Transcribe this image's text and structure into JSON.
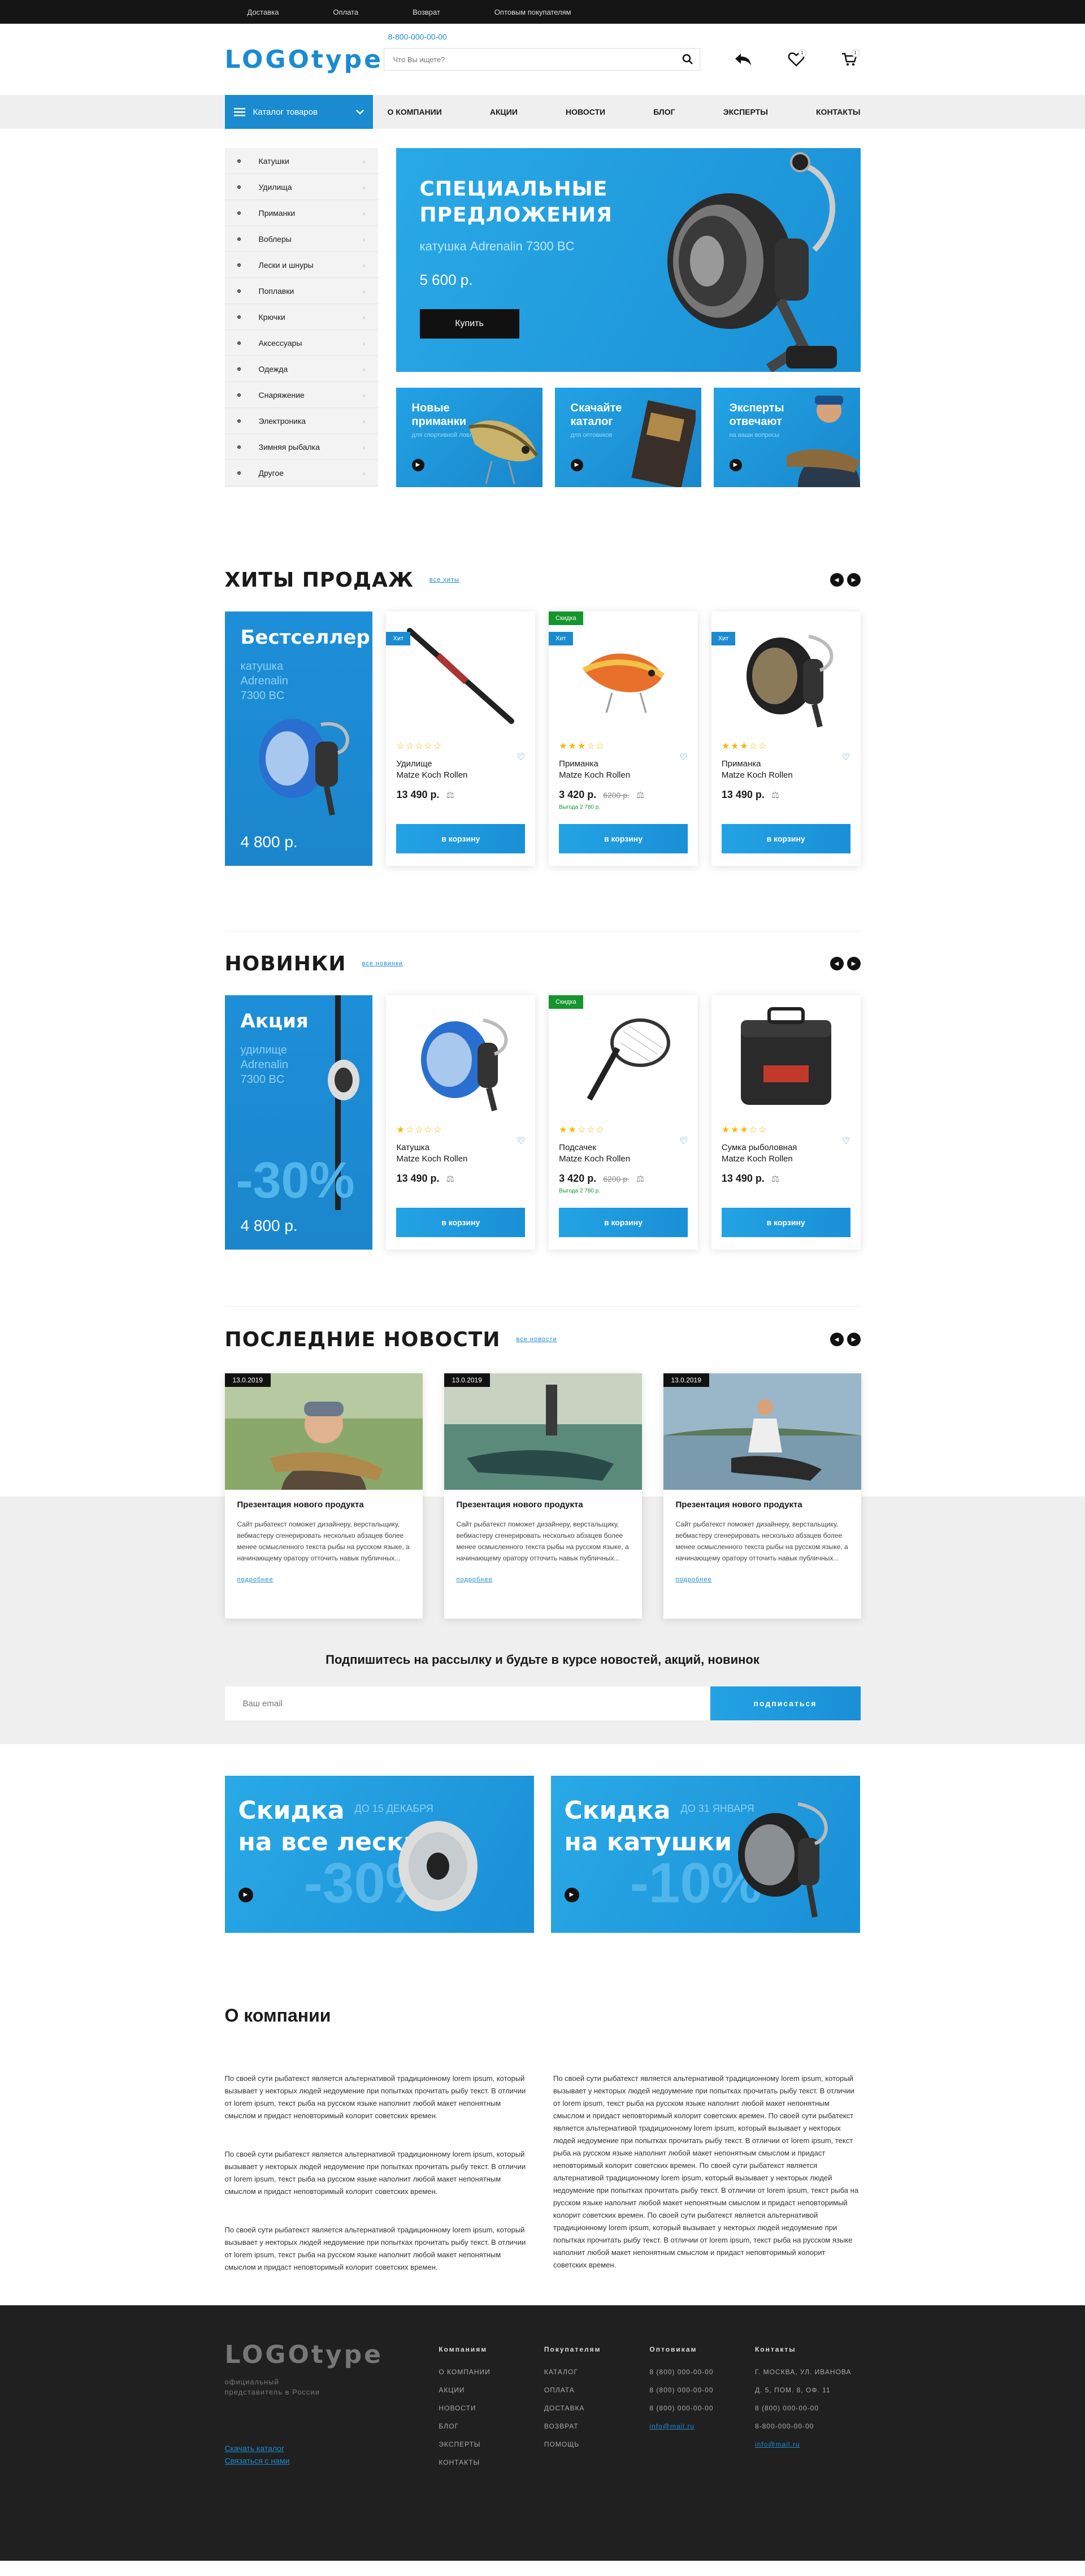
{
  "topbar": {
    "links": [
      "Доставка",
      "Оплата",
      "Возврат",
      "Оптовым покупателям"
    ]
  },
  "header": {
    "logo": "LOGOtype",
    "phone": "8-800-000-00-00",
    "search_placeholder": "Что Вы ищете?",
    "wishlist_count": "1",
    "cart_count": "1"
  },
  "nav": {
    "catalog_label": "Каталог товаров",
    "links": [
      "О КОМПАНИИ",
      "АКЦИИ",
      "НОВОСТИ",
      "БЛОГ",
      "ЭКСПЕРТЫ",
      "КОНТАКТЫ"
    ]
  },
  "categories": [
    "Катушки",
    "Удилища",
    "Приманки",
    "Воблеры",
    "Лески и шнуры",
    "Поплавки",
    "Крючки",
    "Аксессуары",
    "Одежда",
    "Снаряжение",
    "Электроника",
    "Зимняя рыбалка",
    "Другое"
  ],
  "hero": {
    "title_line1": "СПЕЦИАЛЬНЫЕ",
    "title_line2": "ПРЕДЛОЖЕНИЯ",
    "subtitle": "катушка Adrenalin 7300 BC",
    "price": "5 600 р.",
    "buy_label": "Купить"
  },
  "tiles": [
    {
      "title": "Новые приманки",
      "small": "для спортивной ловли"
    },
    {
      "title": "Скачайте каталог",
      "small": "для оптовиков"
    },
    {
      "title": "Эксперты отвечают",
      "small": "на ваши вопросы"
    }
  ],
  "hits": {
    "title": "ХИТЫ ПРОДАЖ",
    "all_label": "все хиты",
    "promo": {
      "title": "Бестселлер",
      "sub": "катушка Adrenalin 7300 BC",
      "price": "4 800 р."
    },
    "products": [
      {
        "tag": "",
        "tag2": "Хит",
        "name1": "Удилище",
        "name2": "Matze Koch Rollen",
        "price": "13 490 р.",
        "old": "",
        "note": "",
        "rating": 0,
        "cart": "в корзину"
      },
      {
        "tag": "Скидка",
        "tag2": "Хит",
        "name1": "Приманка",
        "name2": "Matze Koch Rollen",
        "price": "3 420 р.",
        "old": "6200 р.",
        "note": "Выгода 2 780 р.",
        "rating": 3,
        "cart": "в корзину"
      },
      {
        "tag": "",
        "tag2": "Хит",
        "name1": "Приманка",
        "name2": "Matze Koch Rollen",
        "price": "13 490 р.",
        "old": "",
        "note": "",
        "rating": 3,
        "cart": "в корзину"
      }
    ]
  },
  "novelties": {
    "title": "НОВИНКИ",
    "all_label": "все новинки",
    "promo": {
      "title": "Акция",
      "sub": "удилище Adrenalin 7300 BC",
      "big": "-30%",
      "price": "4 800 р."
    },
    "products": [
      {
        "tag": "",
        "name1": "Катушка",
        "name2": "Matze Koch Rollen",
        "price": "13 490 р.",
        "old": "",
        "note": "",
        "rating": 1,
        "cart": "в корзину"
      },
      {
        "tag": "Скидка",
        "name1": "Подсачек",
        "name2": "Matze Koch Rollen",
        "price": "3 420 р.",
        "old": "6200 р.",
        "note": "Выгода 2 780 р.",
        "rating": 2,
        "cart": "в корзину"
      },
      {
        "tag": "",
        "name1": "Сумка рыболовная",
        "name2": "Matze Koch Rollen",
        "price": "13 490 р.",
        "old": "",
        "note": "",
        "rating": 3,
        "cart": "в корзину"
      }
    ]
  },
  "news": {
    "title": "ПОСЛЕДНИЕ НОВОСТИ",
    "all_label": "все новости",
    "items": [
      {
        "date": "13.0.2019",
        "title": "Презентация нового продукта",
        "text": "Сайт рыбатекст поможет дизайнеру, верстальщику, вебмастеру сгенерировать несколько абзацев более менее осмысленного текста рыбы на русском языке, а начинающему оратору отточить навык публичных...",
        "more": "подробнее"
      },
      {
        "date": "13.0.2019",
        "title": "Презентация нового продукта",
        "text": "Сайт рыбатекст поможет дизайнеру, верстальщику, вебмастеру сгенерировать несколько абзацев более менее осмысленного текста рыбы на русском языке, а начинающему оратору отточить навык публичных...",
        "more": "подробнее"
      },
      {
        "date": "13.0.2019",
        "title": "Презентация нового продукта",
        "text": "Сайт рыбатекст поможет дизайнеру, верстальщику, вебмастеру сгенерировать несколько абзацев более менее осмысленного текста рыбы на русском языке, а начинающему оратору отточить навык публичных...",
        "more": "подробнее"
      }
    ]
  },
  "subscribe": {
    "title": "Подпишитесь на рассылку и будьте в курсе новостей, акций, новинок",
    "placeholder": "Ваш email",
    "button": "подписаться"
  },
  "sales": [
    {
      "line1": "Скидка",
      "line2": "на все лески",
      "until": "ДО 15 ДЕКАБРЯ",
      "pct": "-30%"
    },
    {
      "line1": "Скидка",
      "line2": "на катушки",
      "until": "ДО 31 ЯНВАРЯ",
      "pct": "-10%"
    }
  ],
  "about": {
    "title": "О компании",
    "left": [
      "По своей сути рыбатекст является альтернативой традиционному lorem ipsum, который вызывает у некторых людей недоумение при попытках прочитать рыбу текст. В отличии от lorem ipsum, текст рыба на русском языке наполнит любой макет непонятным смыслом и придаст неповторимый колорит советских времен.",
      "По своей сути рыбатекст является альтернативой традиционному lorem ipsum, который вызывает у некторых людей недоумение при попытках прочитать рыбу текст. В отличии от lorem ipsum, текст рыба на русском языке наполнит любой макет непонятным смыслом и придаст неповторимый колорит советских времен.",
      "По своей сути рыбатекст является альтернативой традиционному lorem ipsum, который вызывает у некторых людей недоумение при попытках прочитать рыбу текст. В отличии от lorem ipsum, текст рыба на русском языке наполнит любой макет непонятным смыслом и придаст неповторимый колорит советских времен."
    ],
    "right": "По своей сути рыбатекст является альтернативой традиционному lorem ipsum, который вызывает у некторых людей недоумение при попытках прочитать рыбу текст. В отличии от lorem ipsum, текст рыба на русском языке наполнит любой макет непонятным смыслом и придаст неповторимый колорит советских времен. По своей сути рыбатекст является альтернативой традиционному lorem ipsum, который вызывает у некторых людей недоумение при попытках прочитать рыбу текст. В отличии от lorem ipsum, текст рыба на русском языке наполнит любой макет непонятным смыслом и придаст неповторимый колорит советских времен. По своей сути рыбатекст является альтернативой традиционному lorem ipsum, который вызывает у некторых людей недоумение при попытках прочитать рыбу текст. В отличии от lorem ipsum, текст рыба на русском языке наполнит любой макет непонятным смыслом и придаст неповторимый колорит советских времен. По своей сути рыбатекст является альтернативой традиционному lorem ipsum, который вызывает у некторых людей недоумение при попытках прочитать рыбу текст. В отличии от lorem ipsum, текст рыба на русском языке наполнит любой макет непонятным смыслом и придаст неповторимый колорит советских времен."
  },
  "footer": {
    "logo": "LOGOtype",
    "tagline": "официальный представитель в России",
    "link1": "Скачать каталог",
    "link2": "Связаться с нами",
    "cols": [
      {
        "title": "Компаниям",
        "items": [
          "О КОМПАНИИ",
          "АКЦИИ",
          "НОВОСТИ",
          "БЛОГ",
          "ЭКСПЕРТЫ",
          "КОНТАКТЫ"
        ]
      },
      {
        "title": "Покупателям",
        "items": [
          "КАТАЛОГ",
          "ОПЛАТА",
          "ДОСТАВКА",
          "ВОЗВРАТ",
          "ПОМОЩЬ"
        ]
      },
      {
        "title": "Оптовикам",
        "items": [
          "8 (800) 000-00-00",
          "8 (800) 000-00-00",
          "8 (800) 000-00-00"
        ],
        "email": "info@mail.ru"
      },
      {
        "title": "Контакты",
        "items": [
          "Г. МОСКВА, УЛ. ИВАНОВА",
          "Д. 5, ПОМ. 8, ОФ. 11",
          "8 (800) 000-00-00",
          "8-800-000-00-00"
        ],
        "email": "info@mail.ru"
      }
    ]
  }
}
